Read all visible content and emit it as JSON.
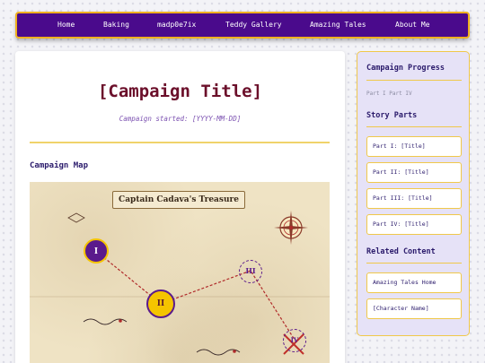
{
  "nav": {
    "items": [
      "Home",
      "Baking",
      "madp0e7ix",
      "Teddy Gallery",
      "Amazing Tales",
      "About Me"
    ]
  },
  "main": {
    "title": "[Campaign Title]",
    "subtitle": "Campaign started: [YYYY-MM-DD]",
    "map_heading": "Campaign Map",
    "map": {
      "banner": "Captain Cadava's Treasure",
      "markers": [
        "I",
        "II",
        "III",
        "IV"
      ]
    }
  },
  "sidebar": {
    "progress_heading": "Campaign Progress",
    "progress_text": "Part I  Part IV",
    "parts_heading": "Story Parts",
    "parts": [
      "Part I: [Title]",
      "Part II: [Title]",
      "Part III: [Title]",
      "Part IV: [Title]"
    ],
    "related_heading": "Related Content",
    "related": [
      "Amazing Tales Home",
      "[Character Name]"
    ]
  },
  "colors": {
    "nav_bg": "#4a0a8c",
    "accent_gold": "#f0b020",
    "title": "#6b0f2a",
    "heading": "#2a1a6b",
    "sidebar_bg": "#e6e2f7",
    "marker_active": "#f5c400",
    "marker_visited": "#5a1a8c",
    "path": "#b02a2a"
  },
  "icons": [
    "compass-icon",
    "path-line",
    "sea-serpent-icon",
    "x-marks-spot-icon"
  ]
}
